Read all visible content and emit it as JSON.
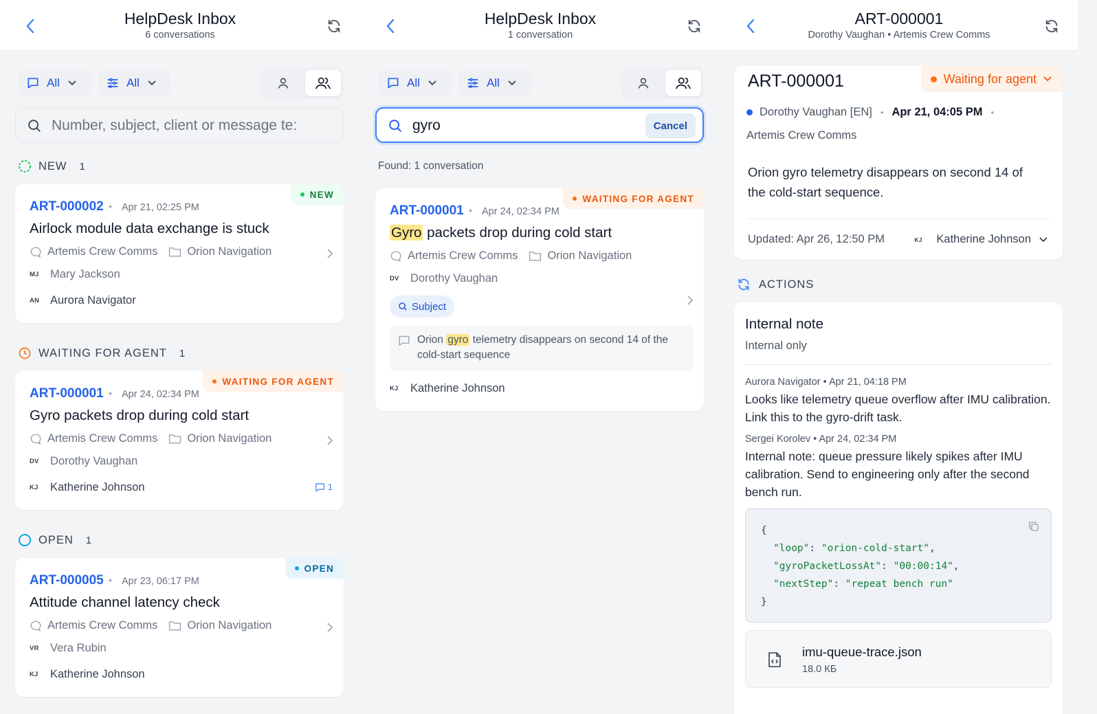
{
  "inbox_list": {
    "header": {
      "title": "HelpDesk Inbox",
      "subtitle": "6 conversations"
    },
    "filters": {
      "channel_label": "All",
      "priority_label": "All"
    },
    "search": {
      "placeholder": "Number, subject, client or message te:"
    },
    "sections": [
      {
        "label": "NEW",
        "count": "1",
        "ticket": {
          "number": "ART-000002",
          "date": "Apr 21, 02:25 PM",
          "badge": "NEW",
          "subject": "Airlock module data exchange is stuck",
          "channel": "Artemis Crew Comms",
          "project": "Orion Navigation",
          "client_initials": "MJ",
          "client": "Mary Jackson",
          "agent_initials": "AN",
          "agent": "Aurora Navigator",
          "messages": ""
        }
      },
      {
        "label": "WAITING FOR AGENT",
        "count": "1",
        "ticket": {
          "number": "ART-000001",
          "date": "Apr 24, 02:34 PM",
          "badge": "WAITING FOR AGENT",
          "subject": "Gyro packets drop during cold start",
          "channel": "Artemis Crew Comms",
          "project": "Orion Navigation",
          "client_initials": "DV",
          "client": "Dorothy Vaughan",
          "agent_initials": "KJ",
          "agent": "Katherine Johnson",
          "messages": "1"
        }
      },
      {
        "label": "OPEN",
        "count": "1",
        "ticket": {
          "number": "ART-000005",
          "date": "Apr 23, 06:17 PM",
          "badge": "OPEN",
          "subject": "Attitude channel latency check",
          "channel": "Artemis Crew Comms",
          "project": "Orion Navigation",
          "client_initials": "VR",
          "client": "Vera Rubin",
          "agent_initials": "KJ",
          "agent": "Katherine Johnson",
          "messages": ""
        }
      }
    ]
  },
  "search_results": {
    "header": {
      "title": "HelpDesk Inbox",
      "subtitle": "1 conversation"
    },
    "filters": {
      "channel_label": "All",
      "priority_label": "All"
    },
    "search": {
      "value": "gyro",
      "cancel_label": "Cancel"
    },
    "found_text": "Found: 1 conversation",
    "result": {
      "number": "ART-000001",
      "date": "Apr 24, 02:34 PM",
      "badge": "WAITING FOR AGENT",
      "subject_highlight": "Gyro",
      "subject_rest": " packets drop during cold start",
      "channel": "Artemis Crew Comms",
      "project": "Orion Navigation",
      "client_initials": "DV",
      "client": "Dorothy Vaughan",
      "match_chip": "Subject",
      "snippet_pre": "Orion ",
      "snippet_highlight": "gyro",
      "snippet_post": " telemetry disappears on second 14 of the cold-start sequence",
      "agent_initials": "KJ",
      "agent": "Katherine Johnson"
    }
  },
  "ticket_detail": {
    "header": {
      "title": "ART-000001",
      "subtitle": "Dorothy Vaughan • Artemis Crew Comms"
    },
    "number": "ART-000001",
    "status": "Waiting for agent",
    "client": "Dorothy Vaughan [EN]",
    "created": "Apr 21, 04:05 PM",
    "channel": "Artemis Crew Comms",
    "description": "Orion gyro telemetry disappears on second 14 of the cold-start sequence.",
    "updated": "Updated: Apr 26, 12:50 PM",
    "assignee_initials": "KJ",
    "assignee": "Katherine Johnson",
    "actions_label": "ACTIONS",
    "note": {
      "title": "Internal note",
      "subtitle": "Internal only",
      "entries": [
        {
          "meta": "Aurora Navigator • Apr 21, 04:18 PM",
          "text": "Looks like telemetry queue overflow after IMU calibration. Link this to the gyro-drift task."
        },
        {
          "meta": "Sergei Korolev • Apr 24, 02:34 PM",
          "text": "Internal note: queue pressure likely spikes after IMU calibration. Send to engineering only after the second bench run."
        }
      ],
      "code": {
        "open": "{",
        "lines": [
          {
            "key": "\"loop\"",
            "value": "\"orion-cold-start\"",
            "comma": ","
          },
          {
            "key": "\"gyroPacketLossAt\"",
            "value": "\"00:00:14\"",
            "comma": ","
          },
          {
            "key": "\"nextStep\"",
            "value": "\"repeat bench run\"",
            "comma": ""
          }
        ],
        "close": "}"
      },
      "attachment": {
        "name": "imu-queue-trace.json",
        "size": "18.0 КБ"
      }
    }
  },
  "colors": {
    "accent": "#2563eb",
    "new": "#22c55e",
    "waiting": "#f97316",
    "open": "#0ea5e9"
  }
}
